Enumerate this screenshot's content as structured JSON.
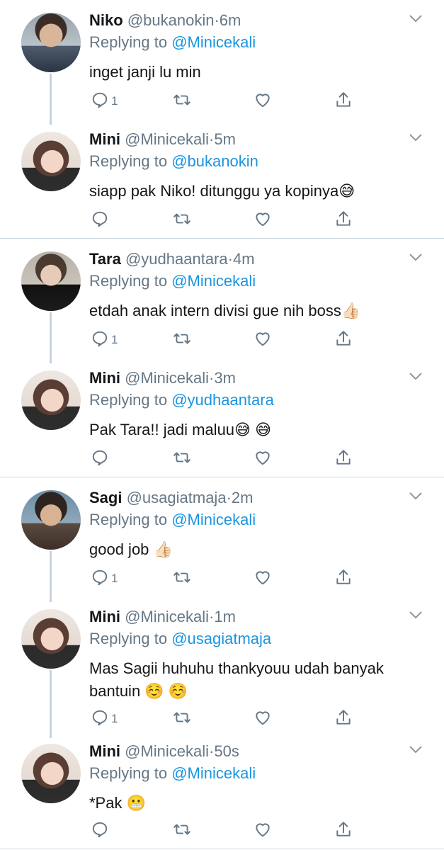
{
  "tweets": [
    {
      "name": "Niko",
      "handle": "@bukanokin",
      "dot": "·",
      "time": "6m",
      "replying_label": "Replying to",
      "replying_to": "@Minicekali",
      "text": "inget janji lu min",
      "replies": "1",
      "avatar": "male"
    },
    {
      "name": "Mini",
      "handle": "@Minicekali",
      "dot": "·",
      "time": "5m",
      "replying_label": "Replying to",
      "replying_to": "@bukanokin",
      "text": "siapp pak Niko! ditunggu ya kopinya😅",
      "replies": "",
      "avatar": "mini"
    },
    {
      "name": "Tara",
      "handle": "@yudhaantara",
      "dot": "·",
      "time": "4m",
      "replying_label": "Replying to",
      "replying_to": "@Minicekali",
      "text": "etdah anak intern divisi gue nih boss👍🏻",
      "replies": "1",
      "avatar": "tara"
    },
    {
      "name": "Mini",
      "handle": "@Minicekali",
      "dot": "·",
      "time": "3m",
      "replying_label": "Replying to",
      "replying_to": "@yudhaantara",
      "text": "Pak Tara!! jadi maluu😅 😅",
      "replies": "",
      "avatar": "mini"
    },
    {
      "name": "Sagi",
      "handle": "@usagiatmaja",
      "dot": "·",
      "time": "2m",
      "replying_label": "Replying to",
      "replying_to": "@Minicekali",
      "text": "good job 👍🏻",
      "replies": "1",
      "avatar": "sagi"
    },
    {
      "name": "Mini",
      "handle": "@Minicekali",
      "dot": "·",
      "time": "1m",
      "replying_label": "Replying to",
      "replying_to": "@usagiatmaja",
      "text": "Mas Sagii huhuhu thankyouu udah banyak bantuin ☺️ ☺️",
      "replies": "1",
      "avatar": "mini"
    },
    {
      "name": "Mini",
      "handle": "@Minicekali",
      "dot": "·",
      "time": "50s",
      "replying_label": "Replying to",
      "replying_to": "@Minicekali",
      "text": "*Pak 😬",
      "replies": "",
      "avatar": "mini"
    }
  ],
  "icons": {
    "comment": "comment-icon",
    "retweet": "retweet-icon",
    "like": "heart-icon",
    "share": "share-icon",
    "more": "chevron-down-icon"
  },
  "colors": {
    "mention": "#1b95e0",
    "secondary": "#657786",
    "thread_line": "#c9d3dc",
    "divider": "#ccd6dd"
  }
}
